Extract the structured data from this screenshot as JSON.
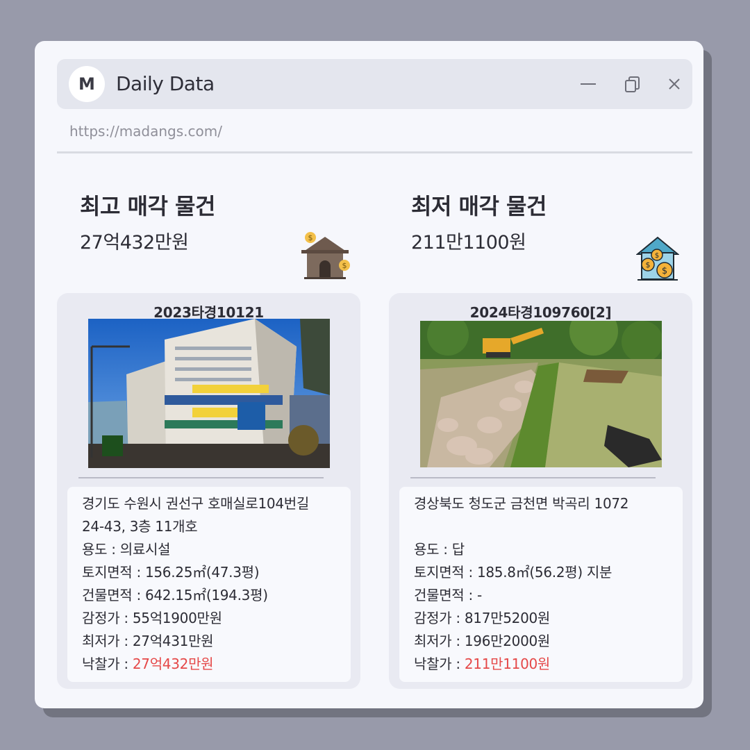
{
  "window": {
    "logo_letter": "M",
    "title": "Daily Data",
    "url": "https://madangs.com/",
    "controls": [
      "minimize-icon",
      "copy-icon",
      "close-icon"
    ]
  },
  "highest": {
    "heading": "최고 매각 물건",
    "price": "27억432만원",
    "icon": "house-money-icon",
    "case_no": "2023타경10121",
    "photo_desc": "building-photo",
    "address_line1": "경기도 수원시 권선구 호매실로104번길",
    "address_line2": "24-43, 3층 11개호",
    "usage_label": "용도 : ",
    "usage": "의료시설",
    "land_label": "토지면적 : ",
    "land": "156.25㎡(47.3평)",
    "building_label": "건물면적 : ",
    "building": "642.15㎡(194.3평)",
    "appraisal_label": "감정가 : ",
    "appraisal": "55억1900만원",
    "minimum_label": "최저가 : ",
    "minimum": "27억431만원",
    "winning_label": "낙찰가 : ",
    "winning": "27억432만원"
  },
  "lowest": {
    "heading": "최저 매각 물건",
    "price": "211만1100원",
    "icon": "house-coins-icon",
    "case_no": "2024타경109760[2]",
    "photo_desc": "field-photo",
    "address_line1": "경상북도 청도군 금천면 박곡리 1072",
    "address_line2": "",
    "usage_label": "용도 : ",
    "usage": " 답",
    "land_label": "토지면적 : ",
    "land": "185.8㎡(56.2평) 지분",
    "building_label": "건물면적 : ",
    "building": "-",
    "appraisal_label": "감정가 : ",
    "appraisal": "817만5200원",
    "minimum_label": "최저가 : ",
    "minimum": "196만2000원",
    "winning_label": "낙찰가 : ",
    "winning": "211만1100원"
  },
  "colors": {
    "background": "#989aaa",
    "window": "#f6f7fc",
    "titlebar": "#e4e6ee",
    "card": "#e9eaf2",
    "accent_red": "#e54848"
  }
}
